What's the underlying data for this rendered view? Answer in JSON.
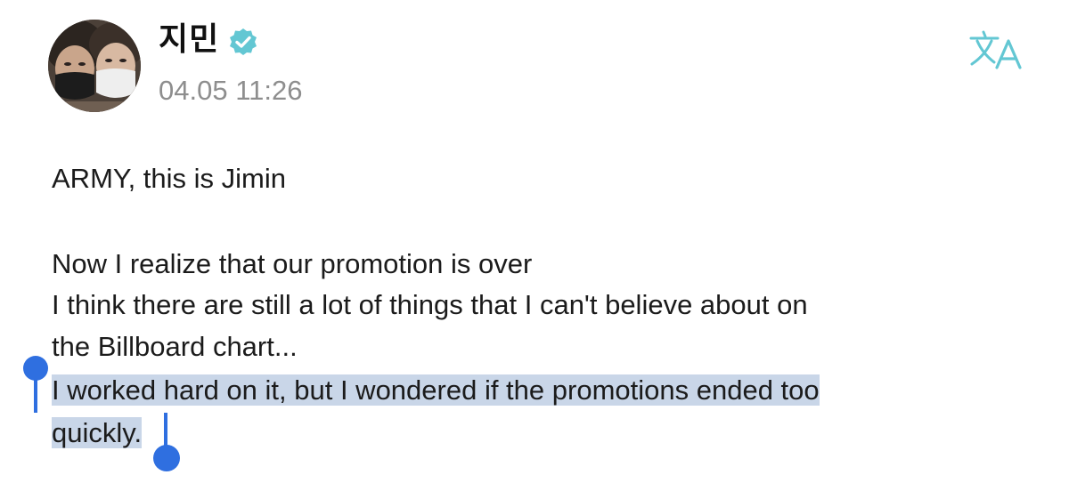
{
  "post": {
    "author": {
      "name": "지민",
      "verified": true,
      "verified_color": "#63c7d3",
      "avatar_icon": "profile-photo"
    },
    "timestamp": "04.05 11:26",
    "translate_icon": "translate-icon",
    "accent_color": "#63c7d3",
    "lines": [
      "ARMY, this is Jimin",
      "Now I realize that our promotion is over",
      "I think there are still a lot of things that I can't believe about on",
      "the Billboard chart...",
      "I worked hard on it, but I wondered if the promotions ended too",
      "quickly."
    ],
    "selection": {
      "highlight_color": "#c9d6e8",
      "handle_color": "#2f6fe0",
      "selected_text": "I worked hard on it, but I wondered if the promotions ended too quickly."
    }
  }
}
